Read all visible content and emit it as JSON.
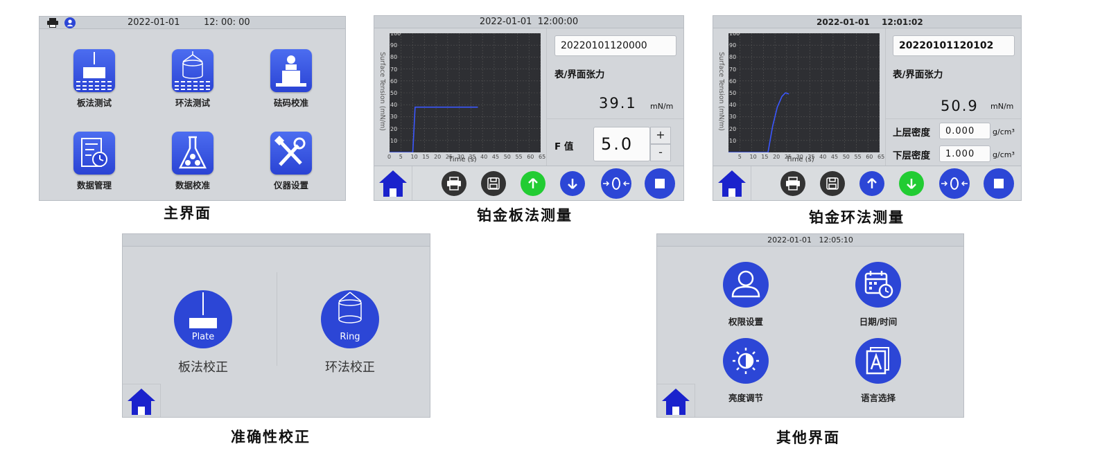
{
  "main_screen": {
    "datetime_date": "2022-01-01",
    "datetime_time": "12: 00: 00",
    "tiles": [
      {
        "label": "板法测试"
      },
      {
        "label": "环法测试"
      },
      {
        "label": "砝码校准"
      },
      {
        "label": "数据管理"
      },
      {
        "label": "数据校准"
      },
      {
        "label": "仪器设置"
      }
    ],
    "caption": "主界面"
  },
  "plate_screen": {
    "datetime": "2022-01-01  12:00:00",
    "record_id": "20220101120000",
    "measure_label": "表/界面张力",
    "value": "39.1",
    "unit": "mN/m",
    "f_label": "F 值",
    "f_value": "5.0",
    "plus": "+",
    "minus": "-",
    "caption": "铂金板法测量",
    "colors": {
      "up_button": "#22cc33",
      "down_button": "#2c46d6"
    }
  },
  "ring_screen": {
    "datetime_date": "2022-01-01",
    "datetime_time": "12:01:02",
    "record_id": "20220101120102",
    "measure_label": "表/界面张力",
    "value": "50.9",
    "unit": "mN/m",
    "upper_density_label": "上层密度",
    "upper_density_value": "0.000",
    "lower_density_label": "下层密度",
    "lower_density_value": "1.000",
    "density_unit": "g/cm³",
    "caption": "铂金环法测量",
    "colors": {
      "up_button": "#2c46d6",
      "down_button": "#22cc33"
    }
  },
  "calibration_screen": {
    "plate_badge": "Plate",
    "ring_badge": "Ring",
    "plate_label": "板法校正",
    "ring_label": "环法校正",
    "caption": "准确性校正"
  },
  "other_screen": {
    "datetime": "2022-01-01   12:05:10",
    "items": [
      {
        "label": "权限设置"
      },
      {
        "label": "日期/时间"
      },
      {
        "label": "亮度调节"
      },
      {
        "label": "语言选择"
      }
    ],
    "caption": "其他界面"
  },
  "chart_data": [
    {
      "type": "line",
      "ylabel": "Surface Tension  (mN/m)",
      "xlabel": "Time  (s)",
      "x_ticks": [
        "0",
        "5",
        "10",
        "15",
        "20",
        "25",
        "30",
        "35",
        "40",
        "45",
        "50",
        "55",
        "60",
        "65"
      ],
      "y_ticks": [
        "10",
        "20",
        "30",
        "40",
        "50",
        "60",
        "70",
        "80",
        "90",
        "100"
      ],
      "xlim": [
        0,
        65
      ],
      "ylim": [
        0,
        100
      ],
      "grid": true,
      "series": [
        {
          "values": [
            [
              0,
              0
            ],
            [
              10,
              0
            ],
            [
              11,
              38
            ],
            [
              38,
              38
            ]
          ],
          "color": "#3b57ff"
        }
      ]
    },
    {
      "type": "line",
      "ylabel": "Surface Tension  (mN/m)",
      "xlabel": "Time  (s)",
      "x_ticks": [
        "5",
        "10",
        "15",
        "20",
        "25",
        "30",
        "35",
        "40",
        "45",
        "50",
        "55",
        "60",
        "65"
      ],
      "y_ticks": [
        "10",
        "20",
        "30",
        "40",
        "50",
        "60",
        "70",
        "80",
        "90",
        "100"
      ],
      "xlim": [
        0,
        65
      ],
      "ylim": [
        0,
        100
      ],
      "grid": true,
      "series": [
        {
          "values": [
            [
              0,
              0
            ],
            [
              17,
              0
            ],
            [
              19,
              22
            ],
            [
              21,
              38
            ],
            [
              23,
              47
            ],
            [
              24.5,
              50
            ],
            [
              26,
              49
            ]
          ],
          "color": "#3b57ff"
        }
      ]
    }
  ]
}
